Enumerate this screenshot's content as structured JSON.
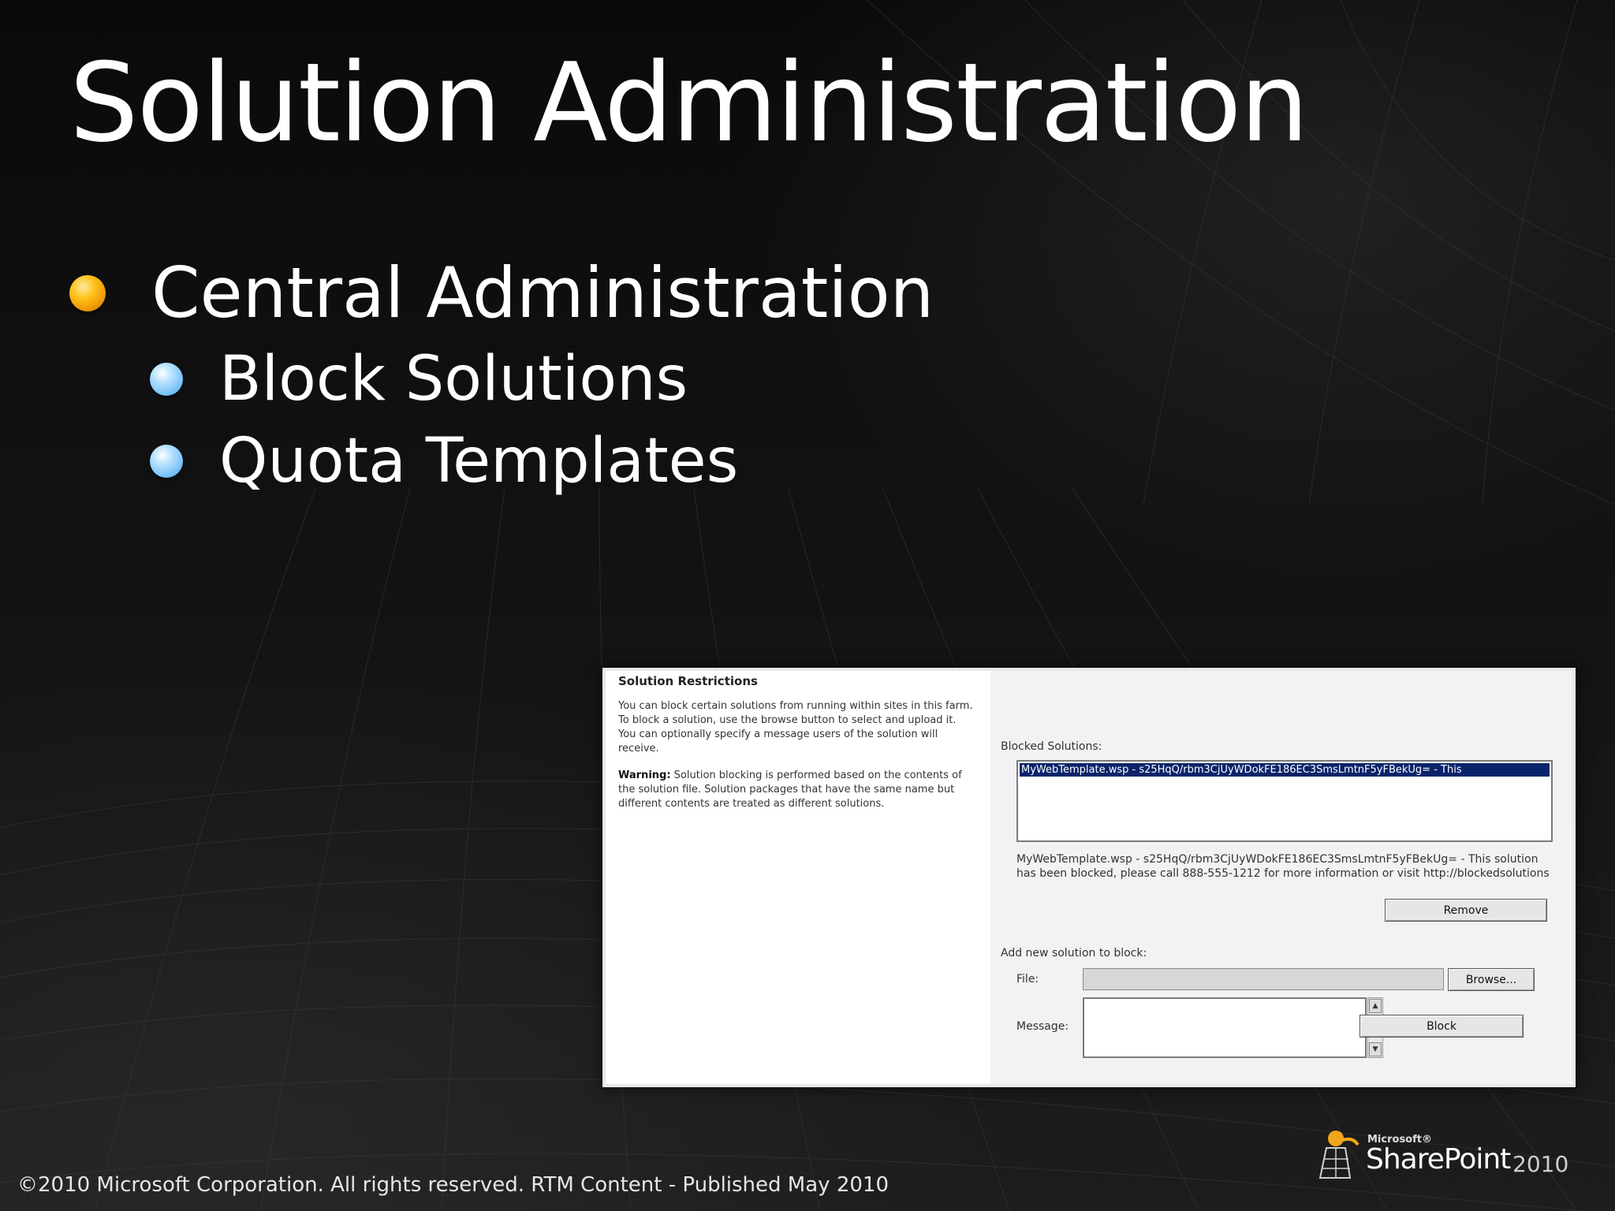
{
  "slide": {
    "title": "Solution Administration",
    "bullets": [
      {
        "text": "Central Administration",
        "level": 1
      },
      {
        "text": "Block Solutions",
        "level": 2
      },
      {
        "text": "Quota Templates",
        "level": 2
      }
    ],
    "footer": "©2010 Microsoft Corporation. All rights reserved. RTM Content - Published May 2010"
  },
  "screenshot": {
    "section_title": "Solution Restrictions",
    "description": "You can block certain solutions from running within sites in this farm. To block a solution, use the browse button to select and upload it. You can optionally specify a message users of the solution will receive.",
    "warning_label": "Warning:",
    "warning_text": "Solution blocking is performed based on the contents of the solution file. Solution packages that have the same name but different contents are treated as different solutions.",
    "blocked_label": "Blocked Solutions:",
    "blocked_items": [
      "MyWebTemplate.wsp - s25HqQ/rbm3CjUyWDokFE186EC3SmsLmtnF5yFBekUg= - This"
    ],
    "blocked_message": "MyWebTemplate.wsp - s25HqQ/rbm3CjUyWDokFE186EC3SmsLmtnF5yFBekUg= - This solution has been blocked, please call 888-555-1212 for more information or visit http://blockedsolutions",
    "remove_button": "Remove",
    "add_label": "Add new solution to block:",
    "file_label": "File:",
    "browse_button": "Browse...",
    "message_label": "Message:",
    "block_button": "Block"
  },
  "logo": {
    "vendor": "Microsoft®",
    "product": "SharePoint",
    "year": "2010"
  }
}
